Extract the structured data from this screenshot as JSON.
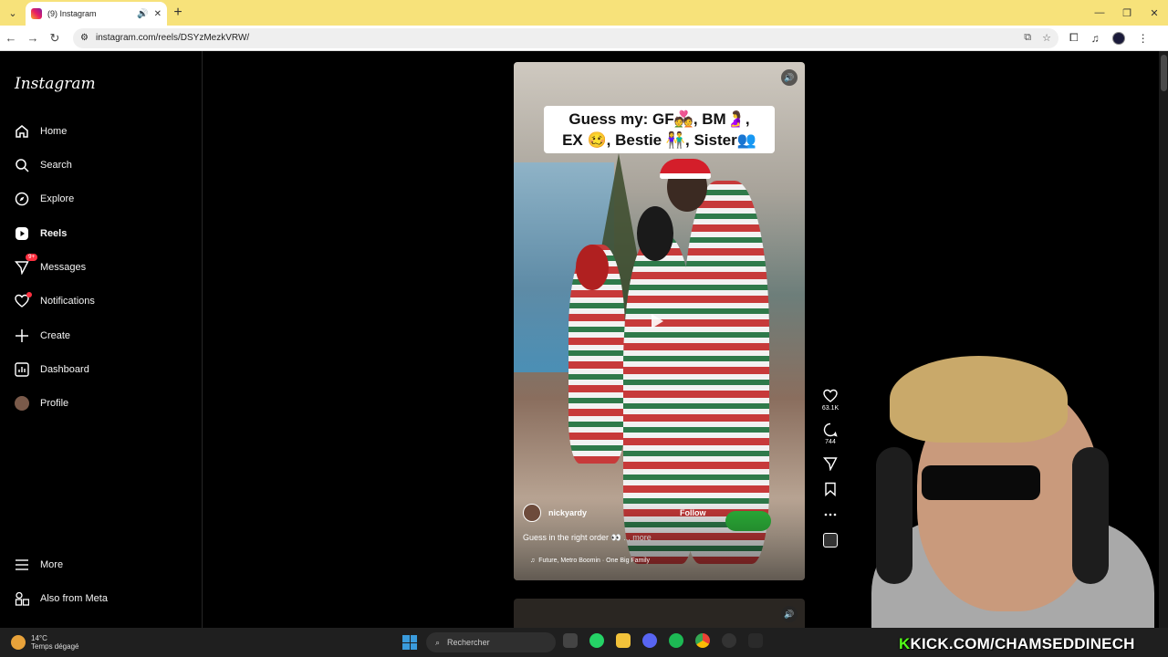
{
  "browser": {
    "tab_title": "(9) Instagram",
    "url": "instagram.com/reels/DSYzMezkVRW/"
  },
  "sidebar": {
    "logo": "Instagram",
    "items": [
      {
        "label": "Home"
      },
      {
        "label": "Search"
      },
      {
        "label": "Explore"
      },
      {
        "label": "Reels"
      },
      {
        "label": "Messages",
        "badge": "9+"
      },
      {
        "label": "Notifications"
      },
      {
        "label": "Create"
      },
      {
        "label": "Dashboard"
      },
      {
        "label": "Profile"
      }
    ],
    "more": "More",
    "also_from_meta": "Also from Meta"
  },
  "reel": {
    "caption_line1": "Guess my: GF💑, BM🤰,",
    "caption_line2": "EX 🥴, Bestie 👫, Sister👥",
    "username": "nickyardy",
    "follow": "Follow",
    "description": "Guess in the right order 👀",
    "more": "... more",
    "music": "Future, Metro Boomin · One Big Family"
  },
  "actions": {
    "likes": "63.1K",
    "comments": "744"
  },
  "taskbar": {
    "temperature": "14°C",
    "weather": "Temps dégagé",
    "search_placeholder": "Rechercher"
  },
  "overlay": {
    "kick_k": "K",
    "kick_text": "KICK.COM/CHAMSEDDINECH"
  },
  "colors": {
    "tab_bar": "#f7e27a",
    "notification_red": "#ff3040",
    "kick_green": "#53fc18"
  }
}
